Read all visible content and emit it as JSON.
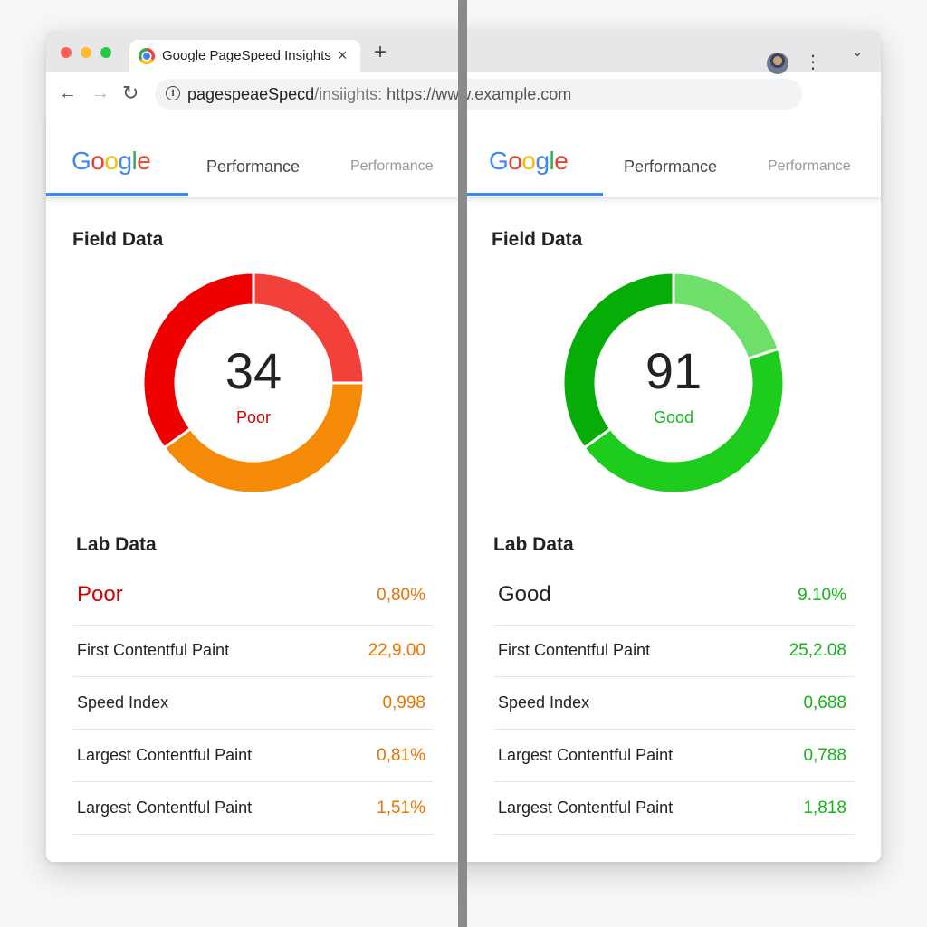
{
  "browser": {
    "tab_title": "Google PageSpeed Insights",
    "tab_close": "×",
    "new_tab": "+",
    "tab_menu": "⌄",
    "nav_back": "←",
    "nav_forward": "→",
    "reload": "↻",
    "info_icon": "i",
    "url_host": "pagespeaeSpecd",
    "url_path": "/insiights: ",
    "url_full": "https://www.example.com",
    "bookmark_icon": "☆",
    "menu_icon": "⋮"
  },
  "left_pane": {
    "logo": {
      "G": "G",
      "o1": "o",
      "o2": "o",
      "g": "g",
      "l": "l",
      "e": "e"
    },
    "tab_active": "Performance",
    "tab_inactive": "Performance",
    "field_title": "Field Data",
    "score": "34",
    "score_label": "Poor",
    "score_color": "#d50000",
    "gauge_segments": [
      {
        "fraction": 0.25,
        "color": "#f2413a"
      },
      {
        "fraction": 0.4,
        "color": "#f58a07"
      },
      {
        "fraction": 0.35,
        "color": "#ef0000"
      }
    ],
    "lab_title": "Lab Data",
    "rating_label": "Poor",
    "rating_label_color": "#d50000",
    "rating_value": "0,80%",
    "value_color": "#e87400",
    "metrics": [
      {
        "label": "First Contentful Paint",
        "value": "22,9.00"
      },
      {
        "label": "Speed Index",
        "value": "0,998"
      },
      {
        "label": "Largest Contentful Paint",
        "value": "0,81%"
      },
      {
        "label": "Largest Contentful Paint",
        "value": "1,51%"
      }
    ]
  },
  "right_pane": {
    "logo": {
      "G": "G",
      "o1": "o",
      "o2": "o",
      "g": "g",
      "l": "l",
      "e": "e"
    },
    "tab_active": "Performance",
    "tab_inactive": "Performance",
    "field_title": "Field Data",
    "score": "91",
    "score_label": "Good",
    "score_color": "#16b31b",
    "gauge_segments": [
      {
        "fraction": 0.2,
        "color": "#6ee06a"
      },
      {
        "fraction": 0.45,
        "color": "#1ecc1e"
      },
      {
        "fraction": 0.35,
        "color": "#06ad06"
      }
    ],
    "lab_title": "Lab Data",
    "rating_label": "Good",
    "rating_label_color": "#222222",
    "rating_value": "9.10%",
    "value_color": "#16b31b",
    "metrics": [
      {
        "label": "First Contentful Paint",
        "value": "25,2.08"
      },
      {
        "label": "Speed Index",
        "value": "0,688"
      },
      {
        "label": "Largest Contentful Paint",
        "value": "0,788"
      },
      {
        "label": "Largest Contentful Paint",
        "value": "1,818"
      }
    ]
  }
}
